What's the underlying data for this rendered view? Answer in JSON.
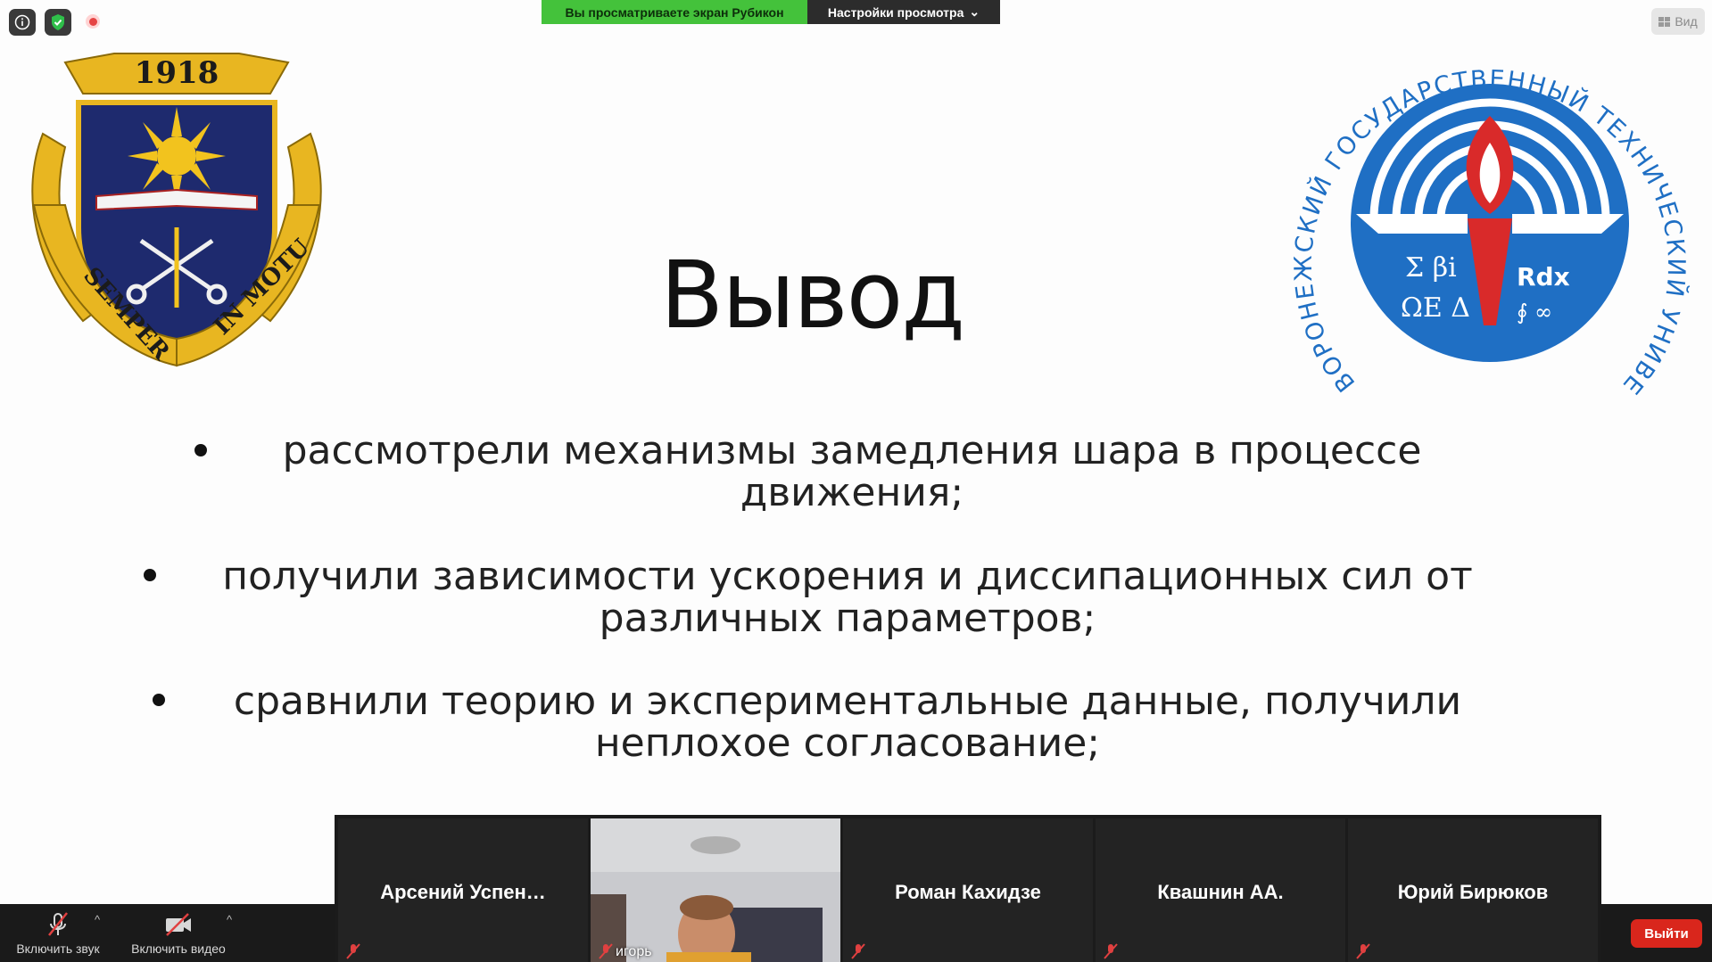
{
  "banner": {
    "share_text": "Вы просматриваете экран Рубикон",
    "view_settings_label": "Настройки просмотра"
  },
  "view_button": {
    "label": "Вид"
  },
  "slide": {
    "title": "Вывод",
    "bullets": [
      {
        "line1": "рассмотрели механизмы замедления шара в процессе",
        "line2": "движения;"
      },
      {
        "line1": "получили зависимости ускорения и диссипационных сил от",
        "line2": "различных параметров;"
      },
      {
        "line1": "сравнили теорию и экспериментальные данные, получили",
        "line2": "неплохое согласование;"
      }
    ],
    "left_logo": {
      "year": "1918",
      "motto_left": "SEMPER",
      "motto_right": "IN MOTU"
    },
    "right_logo": {
      "ring_text": "ВОРОНЕЖСКИЙ ГОСУДАРСТВЕННЫЙ ТЕХНИЧЕСКИЙ УНИВЕРСИТЕТ"
    }
  },
  "participants": [
    {
      "name": "Арсений  Успен…",
      "muted": true
    },
    {
      "name": "игорь",
      "muted": true,
      "video": true
    },
    {
      "name": "Роман Кахидзе",
      "muted": true
    },
    {
      "name": "Квашнин АА.",
      "muted": true
    },
    {
      "name": "Юрий Бирюков",
      "muted": true
    }
  ],
  "toolbar": {
    "mute_label": "Включить звук",
    "video_label": "Включить видео",
    "leave_label": "Выйти"
  },
  "colors": {
    "banner_green": "#44c23b",
    "leave_red": "#d9261c",
    "vgtu_blue": "#1f6fc4",
    "gold": "#e8b621",
    "shield_navy": "#1e2a6e"
  }
}
